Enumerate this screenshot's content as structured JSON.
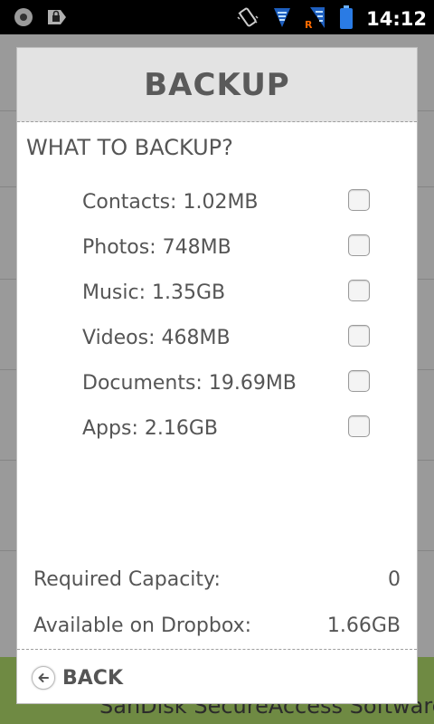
{
  "status_bar": {
    "time": "14:12",
    "icons": [
      "notification-icon",
      "lock-icon",
      "vibrate-icon",
      "wifi-icon",
      "roaming-signal-icon",
      "battery-icon"
    ]
  },
  "background_app": {
    "footer_text": "SanDisk SecureAccess Software"
  },
  "dialog": {
    "title": "BACKUP",
    "section_title": "WHAT TO BACKUP?",
    "items": [
      {
        "label": "Contacts: 1.02MB",
        "checked": false
      },
      {
        "label": "Photos: 748MB",
        "checked": false
      },
      {
        "label": "Music: 1.35GB",
        "checked": false
      },
      {
        "label": "Videos: 468MB",
        "checked": false
      },
      {
        "label": "Documents: 19.69MB",
        "checked": false
      },
      {
        "label": "Apps: 2.16GB",
        "checked": false
      }
    ],
    "summary": {
      "required_label": "Required Capacity:",
      "required_value": "0",
      "available_label": "Available on Dropbox:",
      "available_value": "1.66GB"
    },
    "back_label": "BACK"
  },
  "colors": {
    "header_bg": "#e3e3e3",
    "text": "#555555",
    "status_bar_bg": "#000000"
  }
}
